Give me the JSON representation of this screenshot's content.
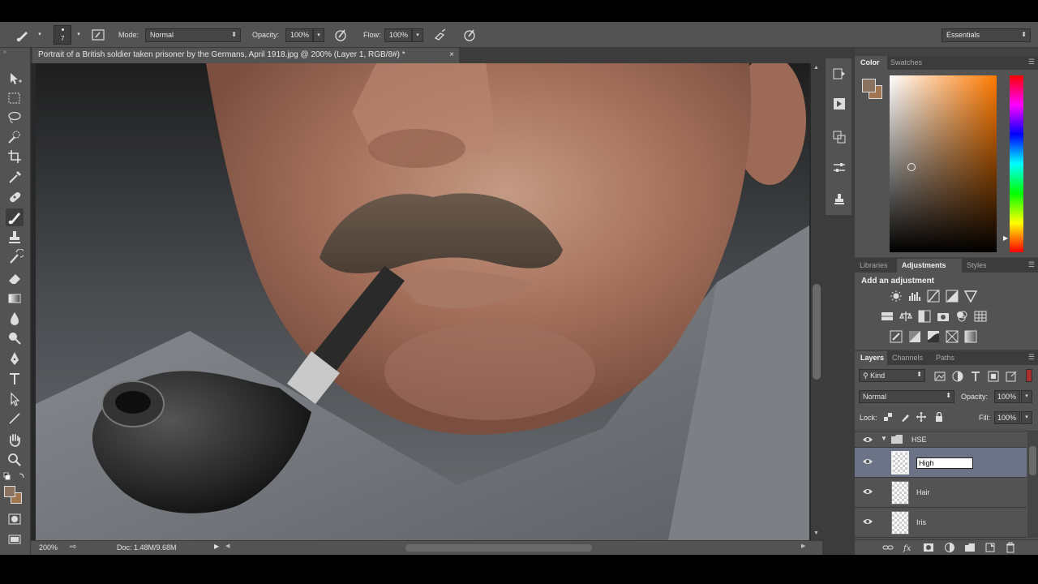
{
  "options_bar": {
    "brush_size": "7",
    "mode_label": "Mode:",
    "mode_value": "Normal",
    "opacity_label": "Opacity:",
    "opacity_value": "100%",
    "flow_label": "Flow:",
    "flow_value": "100%",
    "workspace": "Essentials"
  },
  "document": {
    "tab_title": "Portrait of a British soldier taken prisoner by the Germans, April 1918.jpg @ 200% (Layer 1, RGB/8#) *",
    "close_glyph": "×"
  },
  "status_bar": {
    "zoom": "200%",
    "doc_size": "Doc: 1.48M/9.68M"
  },
  "color_panel": {
    "tabs": [
      "Color",
      "Swatches"
    ],
    "active_tab": "Color",
    "foreground_color": "#8a7260",
    "background_color": "#a07650",
    "picker_hue": "#ff7a00"
  },
  "adjustments_panel": {
    "tabs": [
      "Libraries",
      "Adjustments",
      "Styles"
    ],
    "active_tab": "Adjustments",
    "heading": "Add an adjustment"
  },
  "layers_panel": {
    "tabs": [
      "Layers",
      "Channels",
      "Paths"
    ],
    "active_tab": "Layers",
    "filter_label": "Kind",
    "blend_mode": "Normal",
    "opacity_label": "Opacity:",
    "opacity_value": "100%",
    "lock_label": "Lock:",
    "fill_label": "Fill:",
    "fill_value": "100%",
    "group_name": "HSE",
    "layers": [
      {
        "name": "High",
        "selected": true,
        "renaming": true
      },
      {
        "name": "Hair",
        "selected": false
      },
      {
        "name": "Iris",
        "selected": false
      }
    ]
  },
  "icons": {
    "tools": [
      "move-icon",
      "marquee-icon",
      "lasso-icon",
      "quick-select-icon",
      "crop-icon",
      "eyedropper-icon",
      "healing-brush-icon",
      "brush-icon",
      "clone-stamp-icon",
      "history-brush-icon",
      "eraser-icon",
      "gradient-icon",
      "blur-icon",
      "dodge-icon",
      "pen-icon",
      "type-icon",
      "path-select-icon",
      "line-icon",
      "hand-icon",
      "zoom-icon"
    ]
  }
}
